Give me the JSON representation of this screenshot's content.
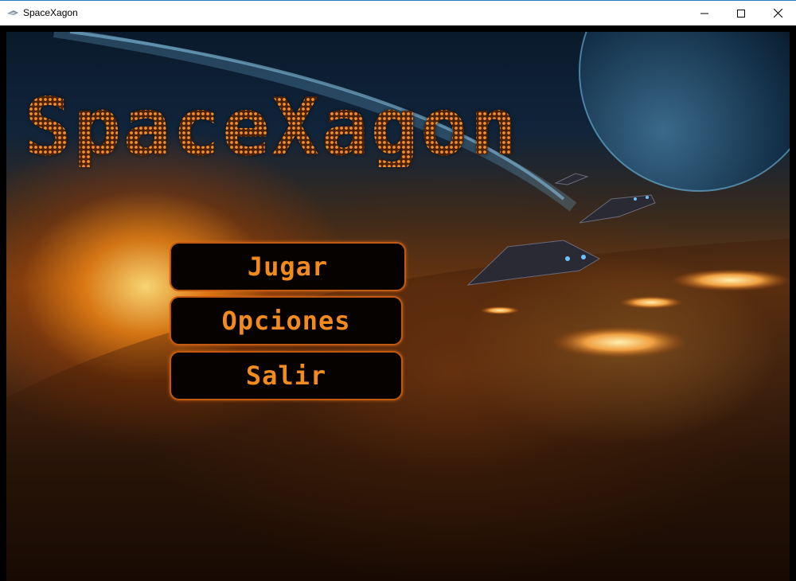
{
  "window": {
    "title": "SpaceXagon",
    "icon": "spaceship-icon",
    "controls": [
      "minimize-icon",
      "maximize-icon",
      "close-icon"
    ]
  },
  "game": {
    "logo": "SpaceXagon",
    "menu": {
      "play_label": "Jugar",
      "options_label": "Opciones",
      "exit_label": "Salir"
    }
  },
  "colors": {
    "accent": "#f28a1e",
    "button_border": "#c05a12",
    "button_bg": "#050200"
  }
}
